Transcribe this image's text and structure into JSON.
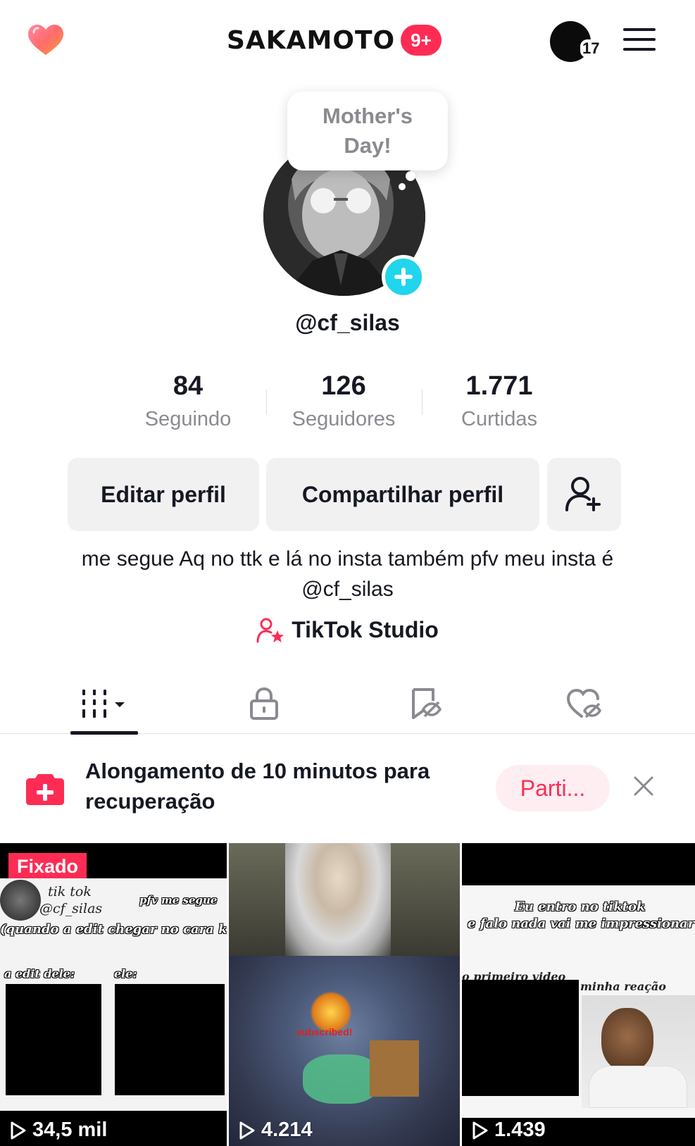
{
  "header": {
    "brand_name": "SAKAMOTO",
    "notification_badge": "9+",
    "story_count": "17"
  },
  "profile": {
    "bubble_text": "Mother's Day!",
    "username": "@cf_silas",
    "stats": [
      {
        "value": "84",
        "label": "Seguindo"
      },
      {
        "value": "126",
        "label": "Seguidores"
      },
      {
        "value": "1.771",
        "label": "Curtidas"
      }
    ],
    "edit_button": "Editar perfil",
    "share_button": "Compartilhar perfil",
    "bio": "me segue Aq no ttk e lá no insta também pfv meu insta é @cf_silas",
    "studio_label": "TikTok Studio"
  },
  "promo": {
    "text": "Alongamento de 10 minutos para recuperação",
    "button": "Parti..."
  },
  "videos": [
    {
      "pinned_label": "Fixado",
      "views": "34,5 mil",
      "caption_name": "tik tok",
      "caption_handle": "@cf_silas",
      "caption_follow": "pfv me segue",
      "caption_main": "(quando a edit chegar no cara kkkk)",
      "caption_left": "a edit dele:",
      "caption_right": "ele:"
    },
    {
      "views": "4.214",
      "overlay_text": "subscribed!"
    },
    {
      "views": "1.439",
      "caption_top1": "Eu entro no tiktok",
      "caption_top2": "e falo nada vai me impressionar",
      "caption_left": "o primeiro video",
      "caption_right": "minha reação"
    }
  ],
  "colors": {
    "accent": "#fe2c55",
    "cyan": "#20d5ec",
    "text": "#161823",
    "muted": "#8a8b91",
    "button_bg": "#f1f1f2"
  },
  "icons": [
    "heart-icon",
    "menu-icon",
    "plus-icon",
    "add-friend-icon",
    "studio-icon",
    "grid-icon",
    "lock-icon",
    "bookmark-hidden-icon",
    "heart-hidden-icon",
    "close-icon",
    "play-icon"
  ]
}
